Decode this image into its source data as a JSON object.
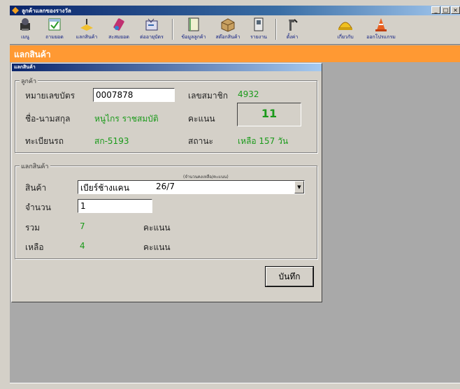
{
  "window": {
    "title": "ลูกค้าแลกของรางวัล",
    "minimize": "_",
    "maximize": "□",
    "close": "×"
  },
  "toolbar": {
    "items": [
      {
        "label": "เมนู",
        "icon": "menu-icon"
      },
      {
        "label": "ถามยอด",
        "icon": "balance-check-icon"
      },
      {
        "label": "แลกสินค้า",
        "icon": "exchange-icon"
      },
      {
        "label": "สะสมยอด",
        "icon": "accumulate-icon"
      },
      {
        "label": "ต่ออายุบัตร",
        "icon": "renew-card-icon"
      },
      {
        "label": "ข้อมูลลูกค้า",
        "icon": "customer-info-icon"
      },
      {
        "label": "สต๊อกสินค้า",
        "icon": "stock-icon"
      },
      {
        "label": "รายงาน",
        "icon": "report-icon"
      },
      {
        "label": "ตั้งค่า",
        "icon": "settings-icon"
      },
      {
        "label": "เกี่ยวกับ",
        "icon": "about-icon"
      },
      {
        "label": "ออกโปรแกรม",
        "icon": "exit-icon"
      }
    ]
  },
  "page": {
    "header": "แลกสินค้า"
  },
  "dialog": {
    "title": "แลกสินค้า",
    "customer_group": {
      "label": "ลูกค้า",
      "card_no_label": "หมายเลขบัตร",
      "card_no_value": "0007878",
      "member_no_label": "เลขสมาชิก",
      "member_no_value": "4932",
      "name_label": "ชื่อ-นามสกุล",
      "name_value": "หนูไกร ราชสมบัติ",
      "points_label": "คะแนน",
      "points_value": "11",
      "registration_label": "ทะเบียนรถ",
      "registration_value": "สก-5193",
      "status_label": "สถานะ",
      "status_value": "เหลือ 157 วัน"
    },
    "exchange_group": {
      "label": "แลกสินค้า",
      "hint": "(จำนวนคงเหลือ/คะแนน)",
      "product_label": "สินค้า",
      "product_value": "เบียร์ช้างแคน",
      "product_stock": "26/7",
      "quantity_label": "จำนวน",
      "quantity_value": "1",
      "total_label": "รวม",
      "total_value": "7",
      "total_unit": "คะแนน",
      "remaining_label": "เหลือ",
      "remaining_value": "4",
      "remaining_unit": "คะแนน"
    },
    "save_label": "บันทึก"
  },
  "colors": {
    "header_orange": "#ff9933",
    "value_green": "#1a9a1a",
    "titlebar_blue": "#0a246a"
  }
}
